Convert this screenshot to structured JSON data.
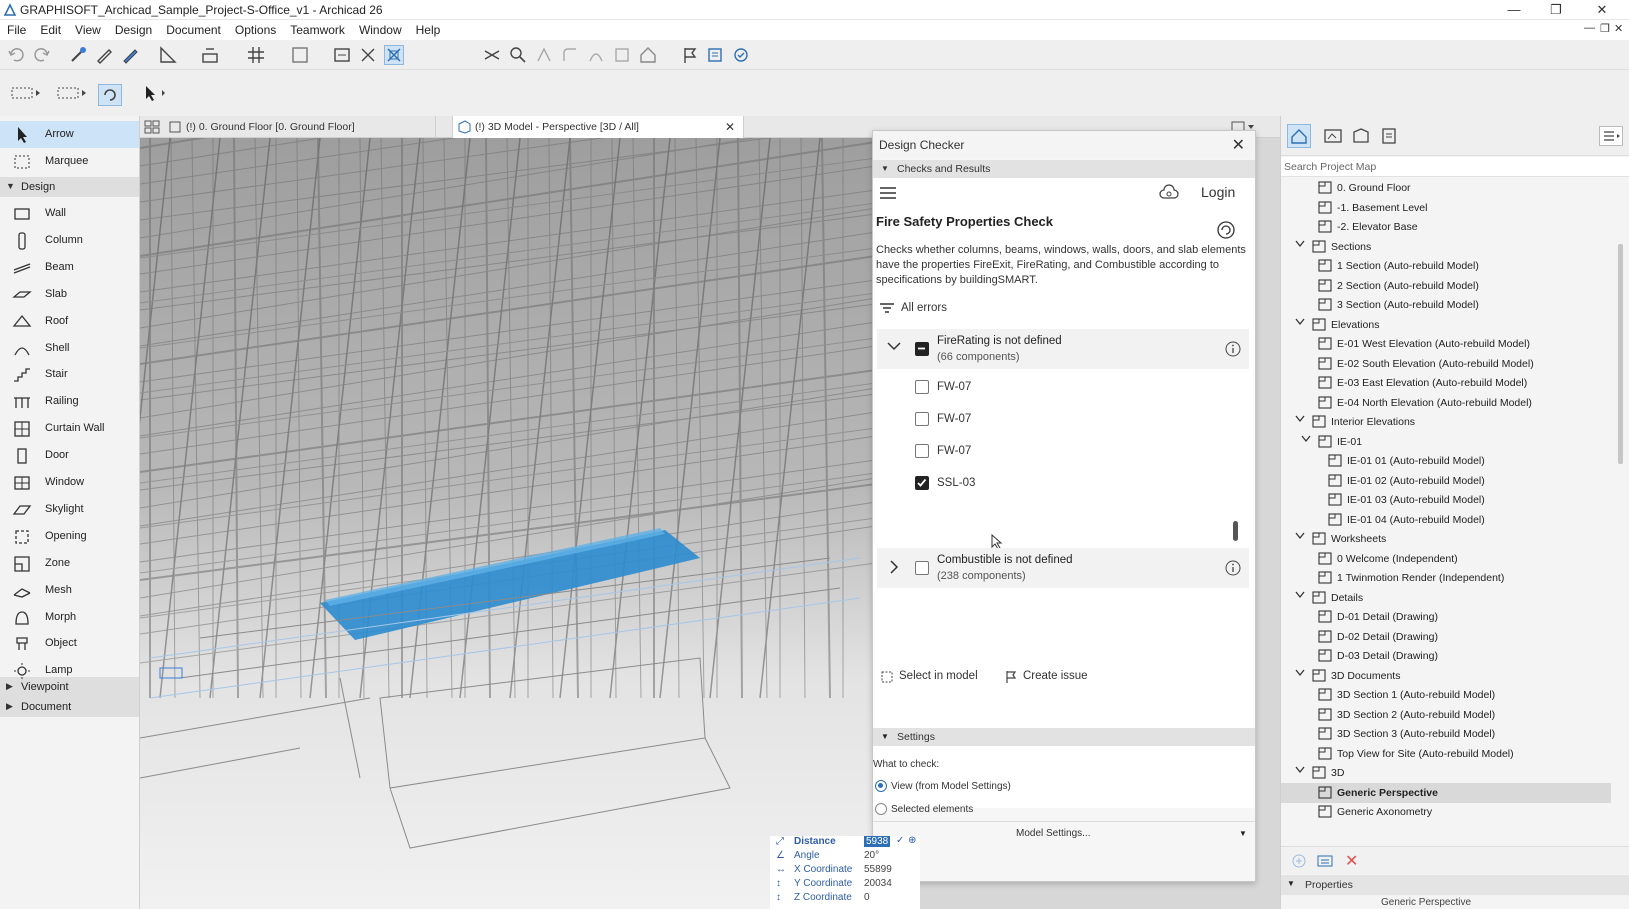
{
  "window": {
    "title": "GRAPHISOFT_Archicad_Sample_Project-S-Office_v1 - Archicad 26"
  },
  "menu": [
    "File",
    "Edit",
    "View",
    "Design",
    "Document",
    "Options",
    "Teamwork",
    "Window",
    "Help"
  ],
  "toolbox": {
    "selection_tools": [
      {
        "label": "Arrow",
        "icon": "arrow-icon",
        "selected": true
      },
      {
        "label": "Marquee",
        "icon": "marquee-icon",
        "selected": false
      }
    ],
    "design_group": "Design",
    "design_tools": [
      {
        "label": "Wall",
        "icon": "wall-icon"
      },
      {
        "label": "Column",
        "icon": "column-icon"
      },
      {
        "label": "Beam",
        "icon": "beam-icon"
      },
      {
        "label": "Slab",
        "icon": "slab-icon"
      },
      {
        "label": "Roof",
        "icon": "roof-icon"
      },
      {
        "label": "Shell",
        "icon": "shell-icon"
      },
      {
        "label": "Stair",
        "icon": "stair-icon"
      },
      {
        "label": "Railing",
        "icon": "railing-icon"
      },
      {
        "label": "Curtain Wall",
        "icon": "curtain-wall-icon"
      },
      {
        "label": "Door",
        "icon": "door-icon"
      },
      {
        "label": "Window",
        "icon": "window-icon"
      },
      {
        "label": "Skylight",
        "icon": "skylight-icon"
      },
      {
        "label": "Opening",
        "icon": "opening-icon"
      },
      {
        "label": "Zone",
        "icon": "zone-icon"
      },
      {
        "label": "Mesh",
        "icon": "mesh-icon"
      },
      {
        "label": "Morph",
        "icon": "morph-icon"
      },
      {
        "label": "Object",
        "icon": "object-icon"
      },
      {
        "label": "Lamp",
        "icon": "lamp-icon"
      }
    ],
    "viewpoint_group": "Viewpoint",
    "document_group": "Document"
  },
  "tabs": [
    {
      "label": "(!) 0. Ground Floor [0. Ground Floor]",
      "active": false
    },
    {
      "label": "(!) 3D Model - Perspective [3D / All]",
      "active": true
    }
  ],
  "design_checker": {
    "title": "Design Checker",
    "section_checks": "Checks and Results",
    "login": "Login",
    "check_title": "Fire Safety Properties Check",
    "description": "Checks whether columns, beams, windows, walls, doors, and slab elements have the properties FireExit, FireRating, and Combustible according to specifications by buildingSMART.",
    "filter": "All errors",
    "groups": [
      {
        "title": "FireRating is not defined",
        "count": "(66 components)",
        "expanded": true,
        "items": [
          {
            "label": "FW-07",
            "checked": false
          },
          {
            "label": "FW-07",
            "checked": false
          },
          {
            "label": "FW-07",
            "checked": false
          },
          {
            "label": "SSL-03",
            "checked": true
          }
        ]
      },
      {
        "title": "Combustible is not defined",
        "count": "(238 components)",
        "expanded": false,
        "items": []
      }
    ],
    "select_in_model": "Select in model",
    "create_issue": "Create issue",
    "settings": "Settings",
    "what_to_check": "What to check:",
    "option_view": "View (from Model Settings)",
    "option_selected": "Selected elements",
    "model_settings": "Model Settings..."
  },
  "coordinates": {
    "distance": {
      "label": "Distance",
      "value": "5938"
    },
    "angle": {
      "label": "Angle",
      "value": "20°"
    },
    "x": {
      "label": "X Coordinate",
      "value": "55899"
    },
    "y": {
      "label": "Y Coordinate",
      "value": "20034"
    },
    "z": {
      "label": "Z Coordinate",
      "value": "0"
    }
  },
  "navigator": {
    "search_placeholder": "Search Project Map",
    "items": [
      {
        "label": "0. Ground Floor",
        "level": 2,
        "icon": "story-icon"
      },
      {
        "label": "-1. Basement Level",
        "level": 2,
        "icon": "story-icon"
      },
      {
        "label": "-2. Elevator Base",
        "level": 2,
        "icon": "story-icon"
      },
      {
        "label": "Sections",
        "level": 1,
        "icon": "section-folder-icon",
        "expander": "v"
      },
      {
        "label": "1 Section (Auto-rebuild Model)",
        "level": 2,
        "icon": "section-icon"
      },
      {
        "label": "2 Section (Auto-rebuild Model)",
        "level": 2,
        "icon": "section-icon"
      },
      {
        "label": "3 Section (Auto-rebuild Model)",
        "level": 2,
        "icon": "section-icon"
      },
      {
        "label": "Elevations",
        "level": 1,
        "icon": "elevation-folder-icon",
        "expander": "v"
      },
      {
        "label": "E-01 West Elevation (Auto-rebuild Model)",
        "level": 2,
        "icon": "elevation-icon"
      },
      {
        "label": "E-02 South Elevation (Auto-rebuild Model)",
        "level": 2,
        "icon": "elevation-icon"
      },
      {
        "label": "E-03 East Elevation (Auto-rebuild Model)",
        "level": 2,
        "icon": "elevation-icon"
      },
      {
        "label": "E-04 North Elevation (Auto-rebuild Model)",
        "level": 2,
        "icon": "elevation-icon"
      },
      {
        "label": "Interior Elevations",
        "level": 1,
        "icon": "interior-elevation-folder-icon",
        "expander": "v"
      },
      {
        "label": "IE-01",
        "level": 2,
        "icon": "interior-elevation-group-icon",
        "expander": "v"
      },
      {
        "label": "IE-01 01 (Auto-rebuild Model)",
        "level": 3,
        "icon": "interior-elevation-icon"
      },
      {
        "label": "IE-01 02 (Auto-rebuild Model)",
        "level": 3,
        "icon": "interior-elevation-icon"
      },
      {
        "label": "IE-01 03 (Auto-rebuild Model)",
        "level": 3,
        "icon": "interior-elevation-icon"
      },
      {
        "label": "IE-01 04 (Auto-rebuild Model)",
        "level": 3,
        "icon": "interior-elevation-icon"
      },
      {
        "label": "Worksheets",
        "level": 1,
        "icon": "worksheet-folder-icon",
        "expander": "v"
      },
      {
        "label": "0 Welcome (Independent)",
        "level": 2,
        "icon": "worksheet-icon"
      },
      {
        "label": "1 Twinmotion Render (Independent)",
        "level": 2,
        "icon": "worksheet-icon"
      },
      {
        "label": "Details",
        "level": 1,
        "icon": "detail-folder-icon",
        "expander": "v"
      },
      {
        "label": "D-01 Detail (Drawing)",
        "level": 2,
        "icon": "detail-icon"
      },
      {
        "label": "D-02 Detail (Drawing)",
        "level": 2,
        "icon": "detail-icon"
      },
      {
        "label": "D-03 Detail (Drawing)",
        "level": 2,
        "icon": "detail-icon"
      },
      {
        "label": "3D Documents",
        "level": 1,
        "icon": "3d-document-folder-icon",
        "expander": "v"
      },
      {
        "label": "3D Section 1 (Auto-rebuild Model)",
        "level": 2,
        "icon": "3d-document-icon"
      },
      {
        "label": "3D Section 2 (Auto-rebuild Model)",
        "level": 2,
        "icon": "3d-document-icon"
      },
      {
        "label": "3D Section 3 (Auto-rebuild Model)",
        "level": 2,
        "icon": "3d-document-icon"
      },
      {
        "label": "Top View for Site (Auto-rebuild Model)",
        "level": 2,
        "icon": "3d-document-icon"
      },
      {
        "label": "3D",
        "level": 1,
        "icon": "3d-folder-icon",
        "expander": "v"
      },
      {
        "label": "Generic Perspective",
        "level": 2,
        "icon": "perspective-icon",
        "selected": true
      },
      {
        "label": "Generic Axonometry",
        "level": 2,
        "icon": "axonometry-icon"
      }
    ],
    "properties_label": "Properties",
    "properties_value": "Generic Perspective"
  },
  "colors": {
    "accent": "#1f8fd0",
    "selection": "#cde3f7",
    "slab_highlight": "#2b8ccf"
  }
}
